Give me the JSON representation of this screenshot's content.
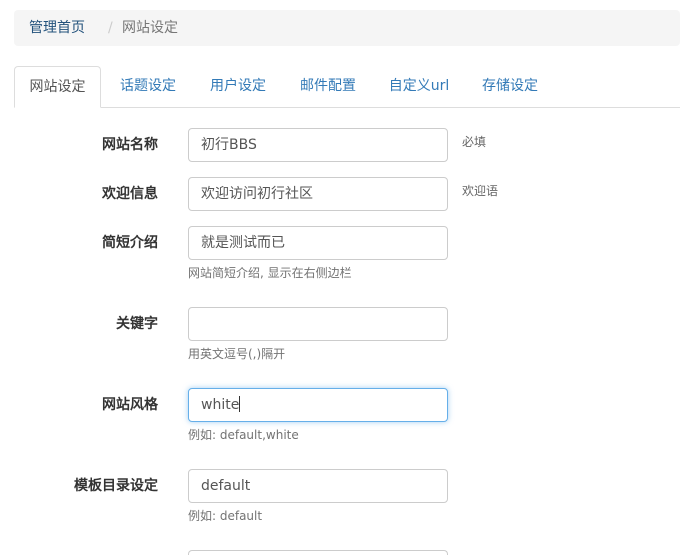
{
  "breadcrumb": {
    "home": "管理首页",
    "separator": "/",
    "current": "网站设定"
  },
  "tabs": [
    {
      "label": "网站设定",
      "active": true
    },
    {
      "label": "话题设定",
      "active": false
    },
    {
      "label": "用户设定",
      "active": false
    },
    {
      "label": "邮件配置",
      "active": false
    },
    {
      "label": "自定义url",
      "active": false
    },
    {
      "label": "存储设定",
      "active": false
    }
  ],
  "form": {
    "site_name": {
      "label": "网站名称",
      "value": "初行BBS",
      "note": "必填"
    },
    "welcome": {
      "label": "欢迎信息",
      "value": "欢迎访问初行社区",
      "note": "欢迎语"
    },
    "intro": {
      "label": "简短介绍",
      "value": "就是测试而已",
      "help": "网站简短介绍, 显示在右侧边栏"
    },
    "keywords": {
      "label": "关键字",
      "value": "",
      "help": "用英文逗号(,)隔开"
    },
    "style": {
      "label": "网站风格",
      "value": "white",
      "help": "例如: default,white"
    },
    "template_dir": {
      "label": "模板目录设定",
      "value": "default",
      "help": "例如: default"
    }
  },
  "colors": {
    "link": "#337ab7",
    "focus_border": "#66afe9"
  }
}
